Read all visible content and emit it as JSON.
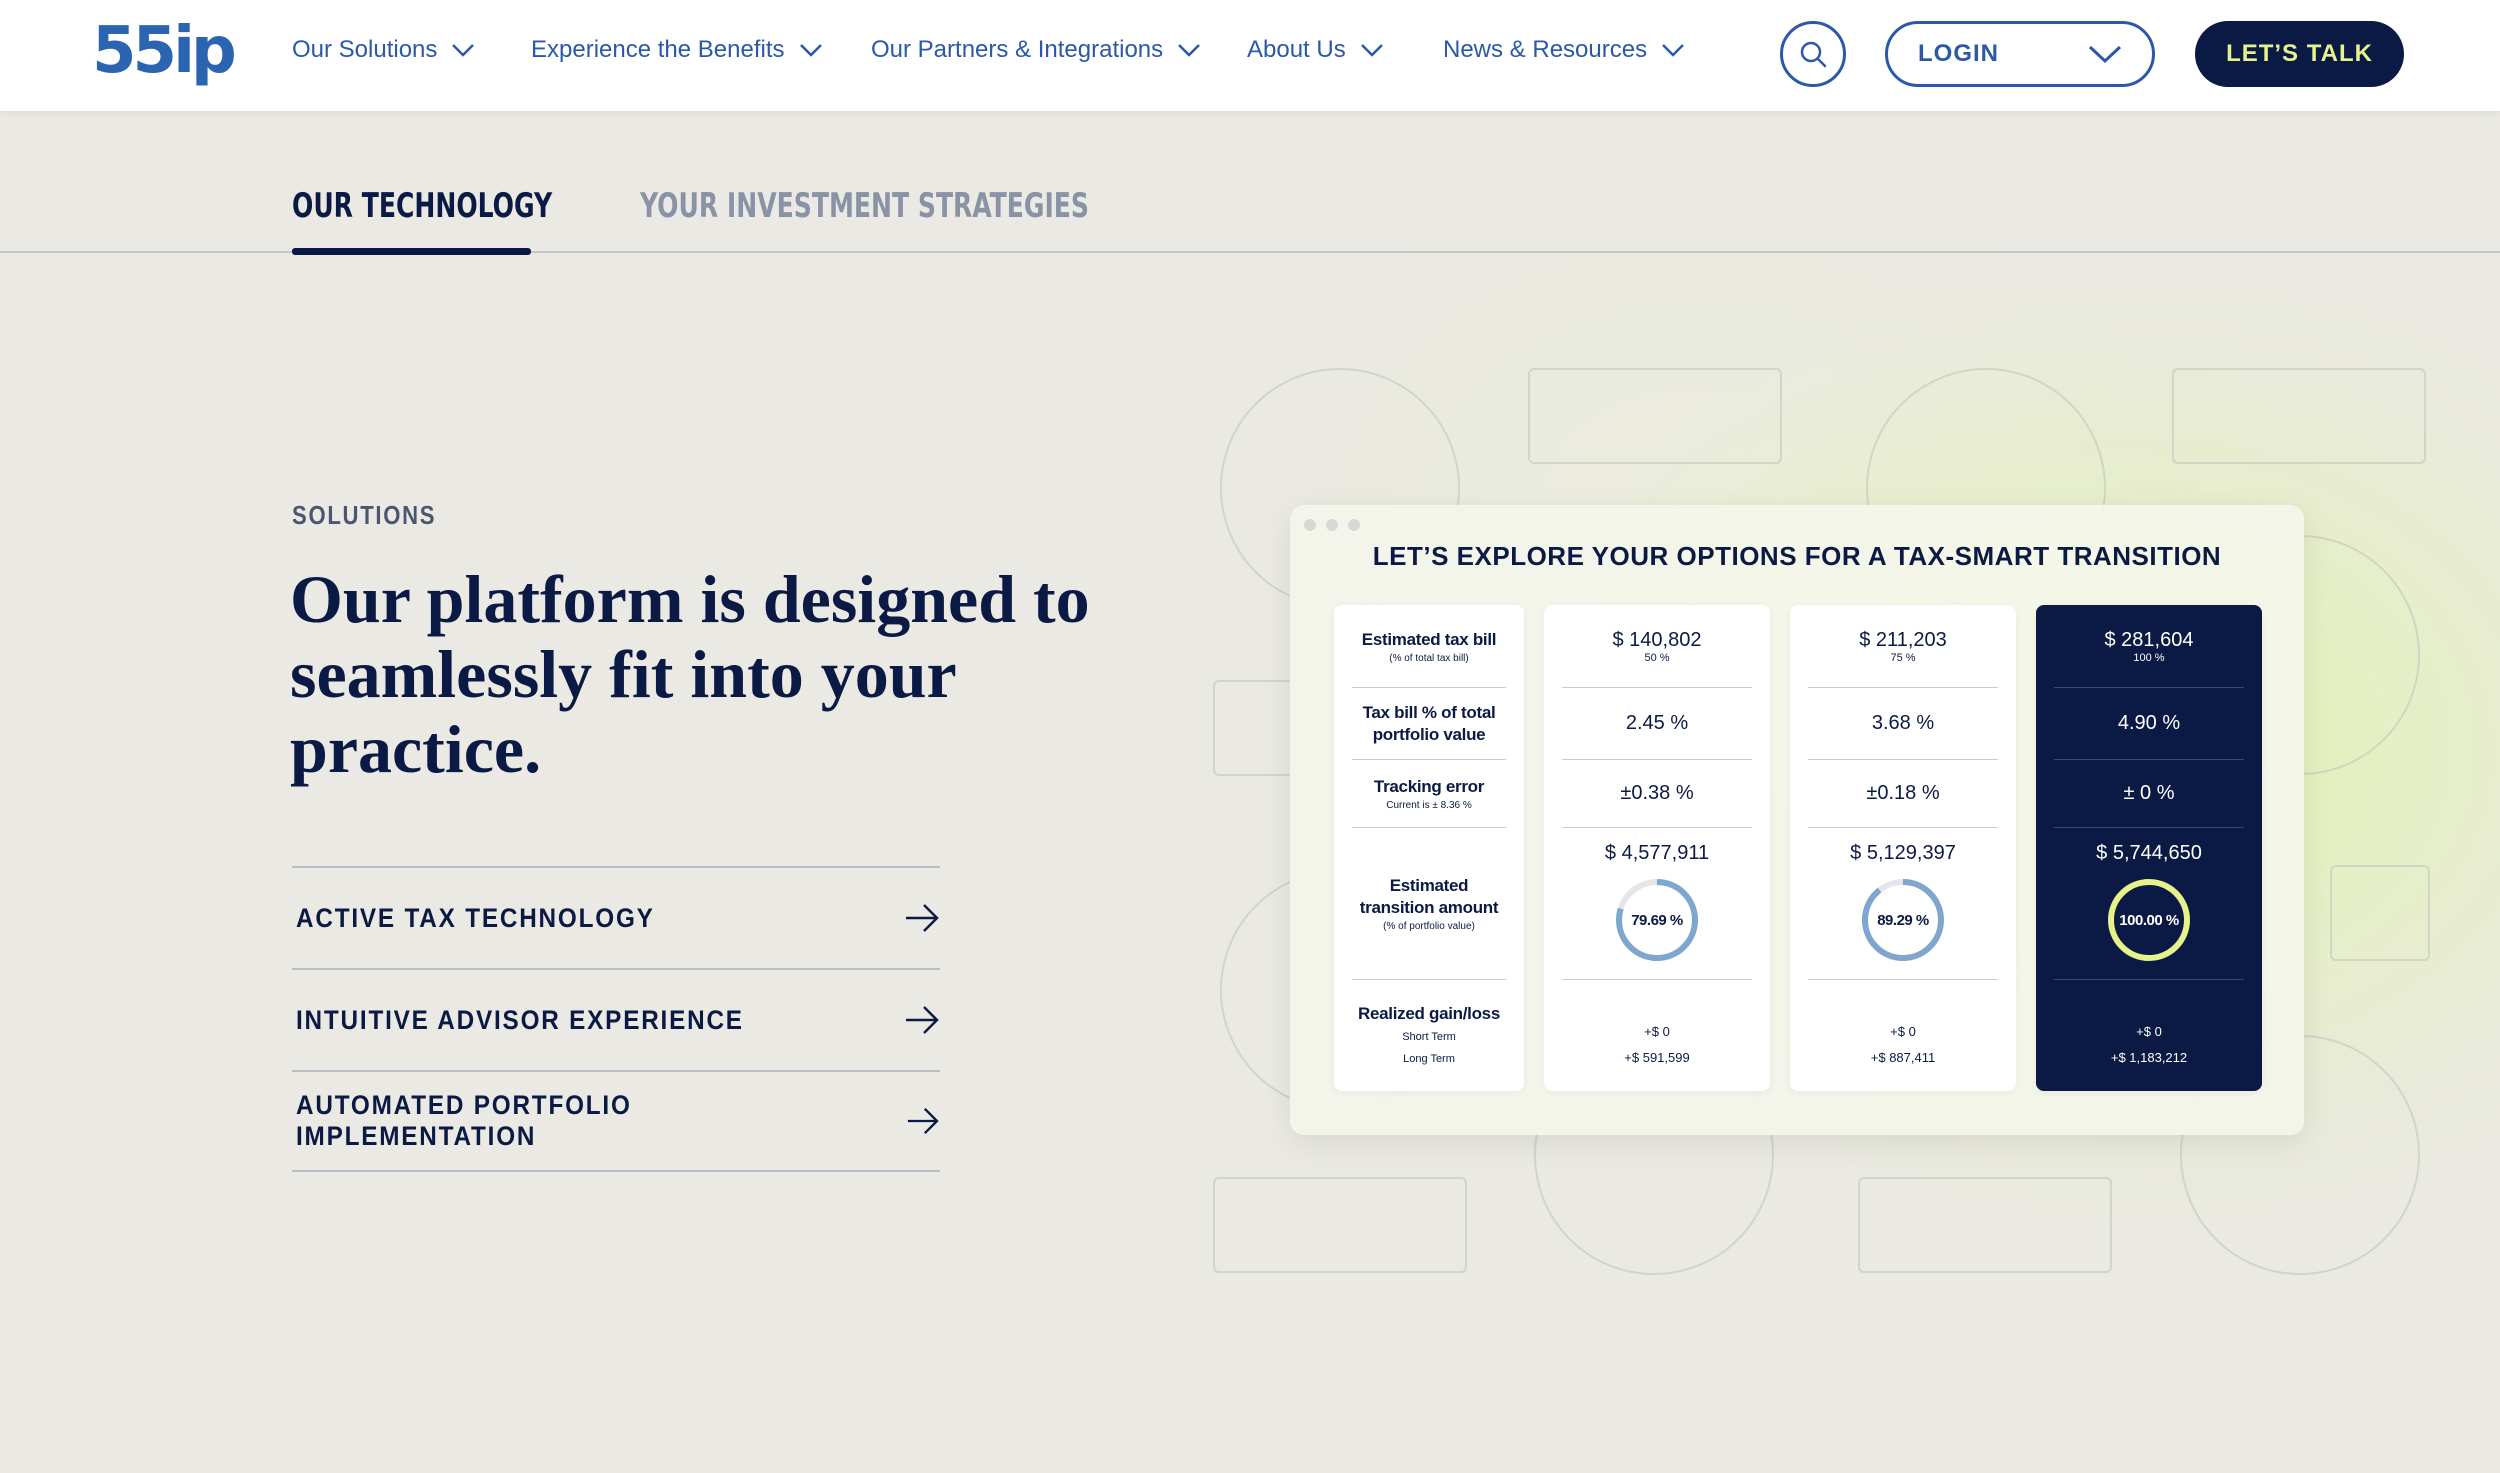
{
  "nav": {
    "logo": "55ip",
    "items": [
      {
        "label": "Our Solutions"
      },
      {
        "label": "Experience the Benefits"
      },
      {
        "label": "Our Partners & Integrations"
      },
      {
        "label": "About Us"
      },
      {
        "label": "News & Resources"
      }
    ],
    "login_label": "LOGIN",
    "cta_label": "LET’S TALK",
    "colors": {
      "primary_blue": "#2b58a8",
      "navy": "#0b1a44",
      "accent_lime": "#e6f28a"
    }
  },
  "tabs": [
    {
      "label": "OUR TECHNOLOGY",
      "active": true
    },
    {
      "label": "YOUR INVESTMENT STRATEGIES",
      "active": false
    }
  ],
  "solutions": {
    "eyebrow": "SOLUTIONS",
    "headline": "Our platform is designed to seamlessly fit into your practice.",
    "items": [
      {
        "label": "ACTIVE TAX TECHNOLOGY"
      },
      {
        "label": "INTUITIVE ADVISOR EXPERIENCE"
      },
      {
        "label": "AUTOMATED PORTFOLIO IMPLEMENTATION"
      }
    ]
  },
  "card": {
    "title": "LET’S EXPLORE YOUR OPTIONS FOR A TAX-SMART TRANSITION",
    "labels": {
      "tax_bill": "Estimated tax bill",
      "tax_bill_sub": "(% of total tax bill)",
      "tax_pct": "Tax bill % of total portfolio value",
      "tracking": "Tracking error",
      "tracking_sub": "Current is ± 8.36 %",
      "transition": "Estimated transition amount",
      "transition_sub": "(% of portfolio value)",
      "gain": "Realized gain/loss",
      "short": "Short Term",
      "long": "Long Term"
    },
    "options": [
      {
        "tax_bill": "$ 140,802",
        "tax_bill_pct": "50 %",
        "tax_pct": "2.45 %",
        "tracking": "±0.38 %",
        "transition": "$ 4,577,911",
        "ring_label": "79.69 %",
        "ring_value": 79.69,
        "short": "+$ 0",
        "long": "+$ 591,599"
      },
      {
        "tax_bill": "$ 211,203",
        "tax_bill_pct": "75 %",
        "tax_pct": "3.68 %",
        "tracking": "±0.18 %",
        "transition": "$ 5,129,397",
        "ring_label": "89.29 %",
        "ring_value": 89.29,
        "short": "+$ 0",
        "long": "+$ 887,411"
      },
      {
        "tax_bill": "$ 281,604",
        "tax_bill_pct": "100 %",
        "tax_pct": "4.90 %",
        "tracking": "± 0 %",
        "transition": "$ 5,744,650",
        "ring_label": "100.00 %",
        "ring_value": 100,
        "short": "+$ 0",
        "long": "+$ 1,183,212"
      }
    ]
  }
}
